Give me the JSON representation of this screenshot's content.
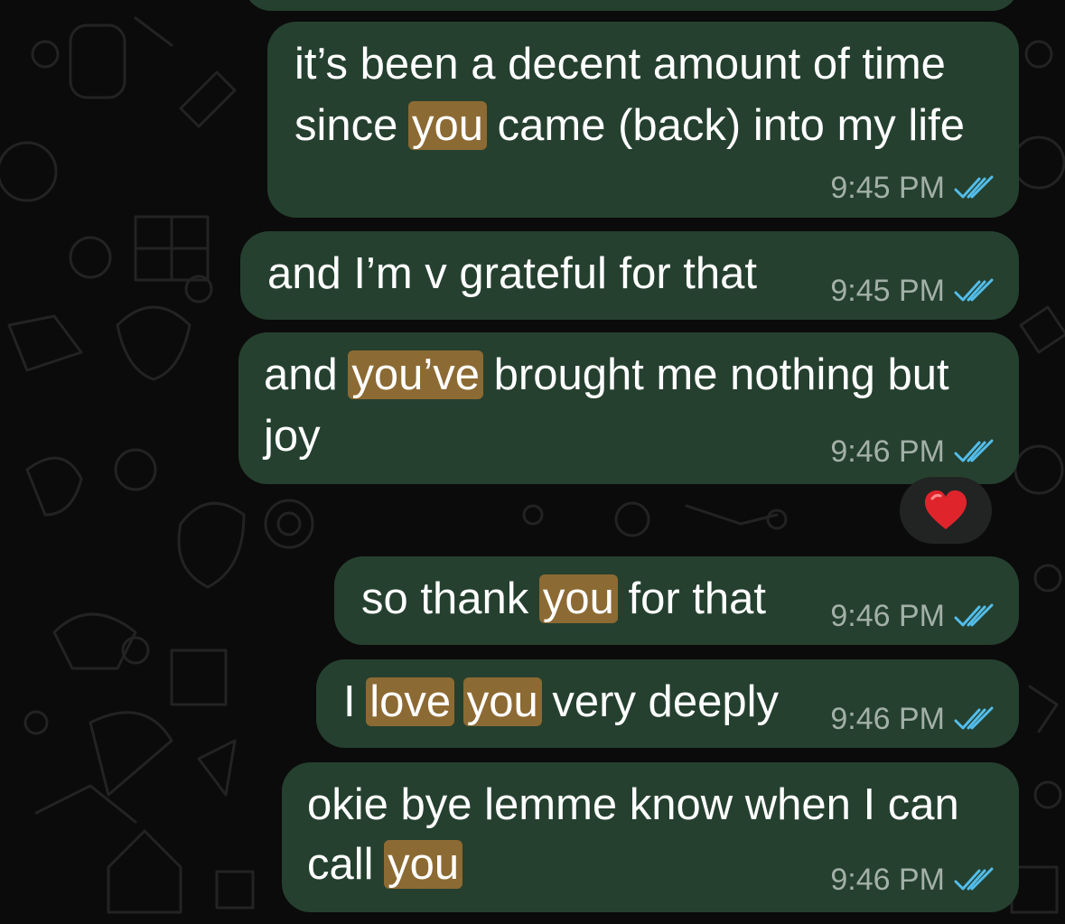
{
  "messages": [
    {
      "parts": [
        {
          "text": "it’s been a decent amount of time"
        },
        {
          "text": "since "
        },
        {
          "text": "you",
          "hl": true
        },
        {
          "text": " came (back) into my life"
        }
      ],
      "time": "9:45 PM"
    },
    {
      "parts": [
        {
          "text": "and I’m v grateful for that"
        }
      ],
      "time": "9:45 PM"
    },
    {
      "parts": [
        {
          "text": "and "
        },
        {
          "text": "you’ve",
          "hl": true
        },
        {
          "text": " brought me nothing but"
        },
        {
          "text": "joy"
        }
      ],
      "time": "9:46 PM"
    },
    {
      "parts": [
        {
          "text": "so thank "
        },
        {
          "text": "you",
          "hl": true
        },
        {
          "text": " for that"
        }
      ],
      "time": "9:46 PM"
    },
    {
      "parts": [
        {
          "text": "I "
        },
        {
          "text": "love",
          "hl": true
        },
        {
          "text": " "
        },
        {
          "text": "you",
          "hl": true
        },
        {
          "text": " very deeply"
        }
      ],
      "time": "9:46 PM"
    },
    {
      "parts": [
        {
          "text": "okie bye lemme know when I can"
        },
        {
          "text": "call "
        },
        {
          "text": "you",
          "hl": true
        }
      ],
      "time": "9:46 PM"
    }
  ],
  "reaction": {
    "emoji": "heart-icon"
  },
  "colors": {
    "bubble": "#25402f",
    "highlight": "#8c6a33",
    "ticks": "#53bdeb",
    "background": "#0b0b0b"
  }
}
